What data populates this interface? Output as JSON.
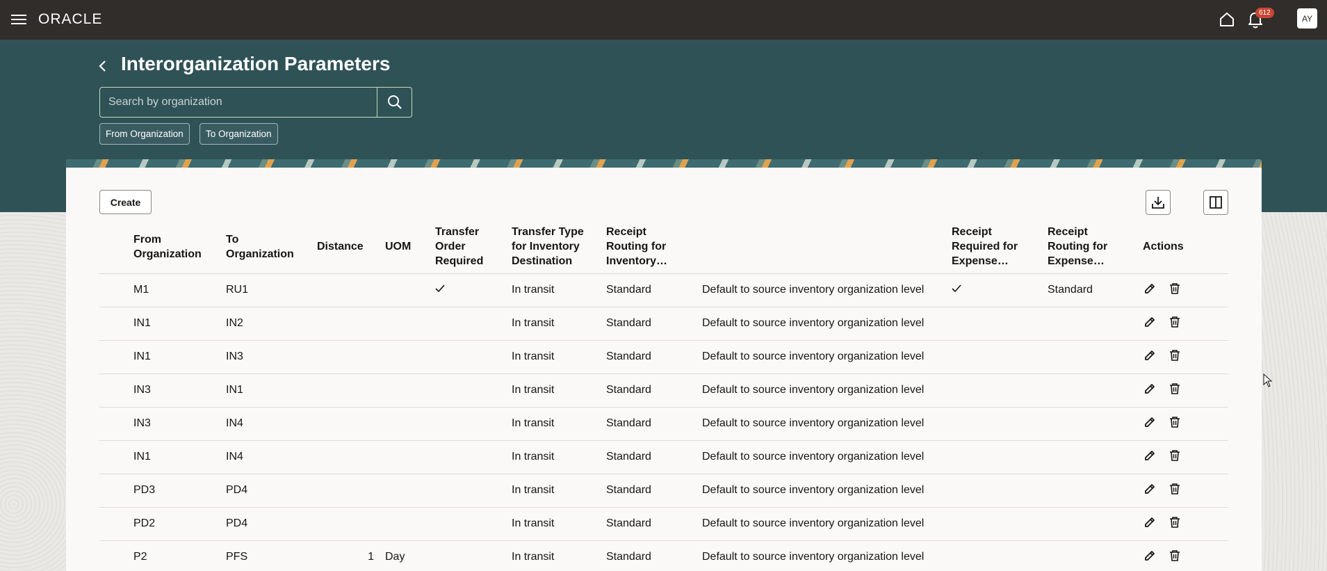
{
  "app": {
    "logo": "ORACLE",
    "notification_count": "612",
    "user_initials": "AY"
  },
  "page": {
    "title": "Interorganization Parameters"
  },
  "search": {
    "placeholder": "Search by organization"
  },
  "filters": [
    {
      "label": "From Organization"
    },
    {
      "label": "To Organization"
    }
  ],
  "toolbar": {
    "create_label": "Create"
  },
  "table": {
    "headers": {
      "from_org": "From Organization",
      "to_org": "To Organization",
      "distance": "Distance",
      "uom": "UOM",
      "transfer_order_required": "Transfer Order Required",
      "transfer_type": "Transfer Type for Inventory Destination",
      "receipt_routing_inventory": "Receipt Routing for Inventory…",
      "col8": "",
      "receipt_required_expense": "Receipt Required for Expense…",
      "receipt_routing_expense": "Receipt Routing for Expense…",
      "actions": "Actions"
    },
    "rows": [
      {
        "from": "M1",
        "to": "RU1",
        "distance": "",
        "uom": "",
        "transfer_order_required": true,
        "transfer_type": "In transit",
        "receipt_routing": "Standard",
        "default": "Default to source inventory organization level",
        "receipt_required_expense": true,
        "receipt_routing_expense": "Standard"
      },
      {
        "from": "IN1",
        "to": "IN2",
        "distance": "",
        "uom": "",
        "transfer_order_required": false,
        "transfer_type": "In transit",
        "receipt_routing": "Standard",
        "default": "Default to source inventory organization level",
        "receipt_required_expense": false,
        "receipt_routing_expense": ""
      },
      {
        "from": "IN1",
        "to": "IN3",
        "distance": "",
        "uom": "",
        "transfer_order_required": false,
        "transfer_type": "In transit",
        "receipt_routing": "Standard",
        "default": "Default to source inventory organization level",
        "receipt_required_expense": false,
        "receipt_routing_expense": ""
      },
      {
        "from": "IN3",
        "to": "IN1",
        "distance": "",
        "uom": "",
        "transfer_order_required": false,
        "transfer_type": "In transit",
        "receipt_routing": "Standard",
        "default": "Default to source inventory organization level",
        "receipt_required_expense": false,
        "receipt_routing_expense": ""
      },
      {
        "from": "IN3",
        "to": "IN4",
        "distance": "",
        "uom": "",
        "transfer_order_required": false,
        "transfer_type": "In transit",
        "receipt_routing": "Standard",
        "default": "Default to source inventory organization level",
        "receipt_required_expense": false,
        "receipt_routing_expense": ""
      },
      {
        "from": "IN1",
        "to": "IN4",
        "distance": "",
        "uom": "",
        "transfer_order_required": false,
        "transfer_type": "In transit",
        "receipt_routing": "Standard",
        "default": "Default to source inventory organization level",
        "receipt_required_expense": false,
        "receipt_routing_expense": ""
      },
      {
        "from": "PD3",
        "to": "PD4",
        "distance": "",
        "uom": "",
        "transfer_order_required": false,
        "transfer_type": "In transit",
        "receipt_routing": "Standard",
        "default": "Default to source inventory organization level",
        "receipt_required_expense": false,
        "receipt_routing_expense": ""
      },
      {
        "from": "PD2",
        "to": "PD4",
        "distance": "",
        "uom": "",
        "transfer_order_required": false,
        "transfer_type": "In transit",
        "receipt_routing": "Standard",
        "default": "Default to source inventory organization level",
        "receipt_required_expense": false,
        "receipt_routing_expense": ""
      },
      {
        "from": "P2",
        "to": "PFS",
        "distance": "1",
        "uom": "Day",
        "transfer_order_required": false,
        "transfer_type": "In transit",
        "receipt_routing": "Standard",
        "default": "Default to source inventory organization level",
        "receipt_required_expense": false,
        "receipt_routing_expense": ""
      }
    ]
  },
  "colors": {
    "topbar": "#312d2a",
    "band": "#2f5257",
    "card": "#fbf9f8",
    "badge": "#c74634"
  },
  "icons": [
    "hamburger-icon",
    "home-icon",
    "bell-icon",
    "back-icon",
    "search-icon",
    "download-icon",
    "columns-icon",
    "edit-icon",
    "delete-icon",
    "check-icon",
    "mouse-cursor-icon"
  ]
}
